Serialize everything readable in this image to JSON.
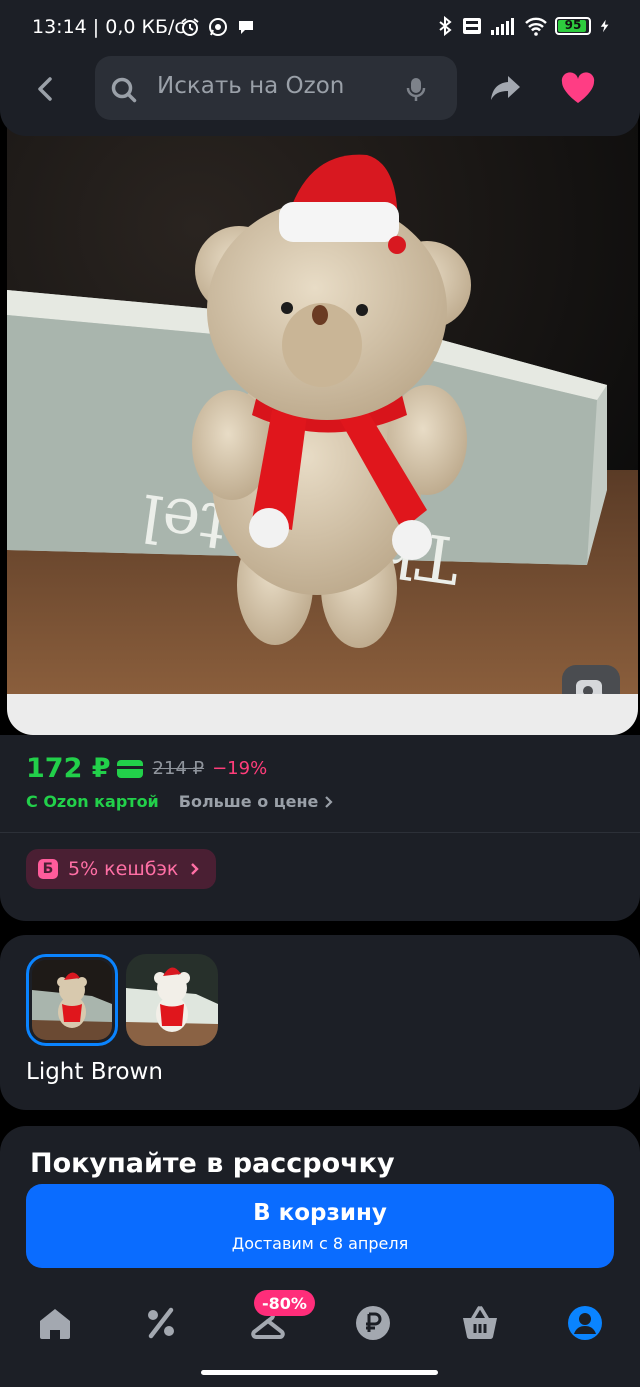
{
  "status_bar": {
    "time": "13:14 | 0,0 КБ/с",
    "battery": "95",
    "battery_level": 0.95
  },
  "header": {
    "search_placeholder": "Искать на Ozon",
    "icons": [
      "back-icon",
      "search-icon",
      "mic-icon",
      "share-icon",
      "heart-icon"
    ],
    "favorite_color": "#ff3d84"
  },
  "product": {
    "image_alt_icon": "image-search-icon",
    "price_current": "172 ₽",
    "price_old": "214 ₽",
    "discount": "−19%",
    "ozon_card_label": "С Ozon картой",
    "more_price_label": "Больше о цене",
    "cashback_badge": "Б",
    "cashback_label": "5% кешбэк",
    "price_color": "#22d04a",
    "discount_color": "#ff3d7a"
  },
  "variants": {
    "selected_label": "Light Brown",
    "items": [
      {
        "name": "variant-light-brown",
        "selected": true
      },
      {
        "name": "variant-white",
        "selected": false
      }
    ]
  },
  "installment": {
    "title": "Покупайте в рассрочку"
  },
  "cart_button": {
    "title": "В корзину",
    "subtitle": "Доставим с 8 апреля",
    "color": "#0a6cff"
  },
  "bottom_nav": {
    "badge": "-80%",
    "items": [
      "home-icon",
      "percent-icon",
      "fresh-icon",
      "ruble-icon",
      "cart-icon",
      "profile-icon"
    ],
    "active": "profile-icon",
    "active_color": "#0a84ff"
  }
}
